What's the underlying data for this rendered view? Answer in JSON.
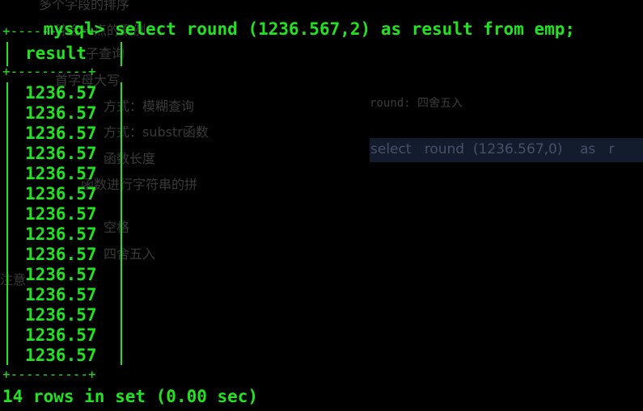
{
  "colors": {
    "background": "#000000",
    "terminal_text": "#21e321",
    "ghost_text": "#3a3a3a",
    "ghost_highlight": "#131c2c"
  },
  "terminal": {
    "prompt": "mysql>",
    "command": "select round (1236.567,2) as result from emp;",
    "border_top": "+----------+",
    "header": "result",
    "border_mid": "+----------+",
    "rows": [
      "1236.57",
      "1236.57",
      "1236.57",
      "1236.57",
      "1236.57",
      "1236.57",
      "1236.57",
      "1236.57",
      "1236.57",
      "1236.57",
      "1236.57",
      "1236.57",
      "1236.57",
      "1236.57"
    ],
    "border_bottom": "+----------+",
    "summary": "14 rows in set (0.00 sec)"
  },
  "background_ghost": {
    "left_items": [
      "多个字段的排序",
      "综合一点的案例",
      "子查询",
      "首字母大写",
      "方式：模糊查询",
      "方式：substr函数",
      "函数长度",
      "函数进行字符串的拼",
      "空格",
      "四舍五入",
      "注意"
    ],
    "right_note": "round: 四舍五入",
    "right_code": "select   round  (1236.567,0)    as   r"
  }
}
